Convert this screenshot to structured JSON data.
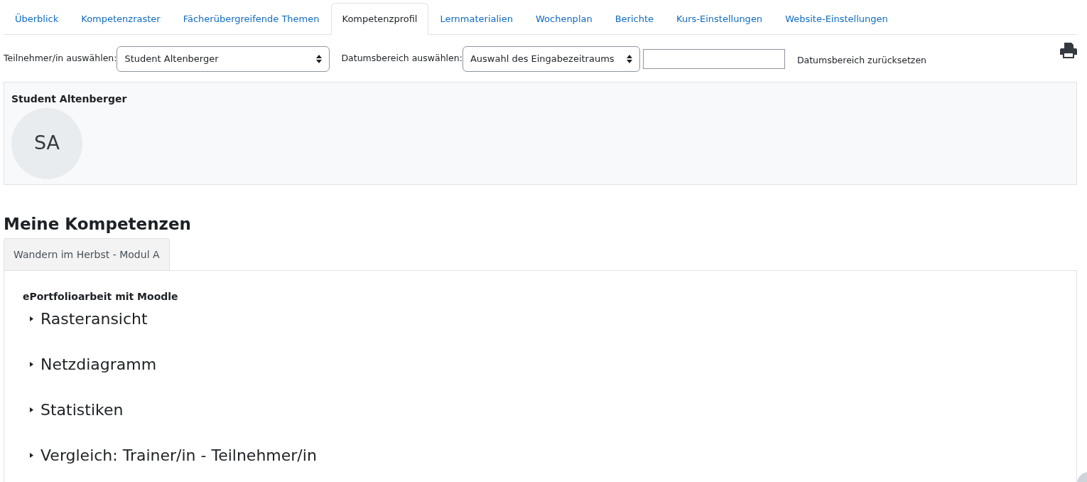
{
  "tabs": [
    {
      "label": "Überblick",
      "selected": false
    },
    {
      "label": "Kompetenzraster",
      "selected": false
    },
    {
      "label": "Fächerübergreifende Themen",
      "selected": false
    },
    {
      "label": "Kompetenzprofil",
      "selected": true
    },
    {
      "label": "Lernmaterialien",
      "selected": false
    },
    {
      "label": "Wochenplan",
      "selected": false
    },
    {
      "label": "Berichte",
      "selected": false
    },
    {
      "label": "Kurs-Einstellungen",
      "selected": false
    },
    {
      "label": "Website-Einstellungen",
      "selected": false
    }
  ],
  "filters": {
    "participant_label": "Teilnehmer/in auswählen:",
    "participant_value": "Student Altenberger",
    "date_label": "Datumsbereich auswählen:",
    "date_value": "Auswahl des Eingabezeitraums",
    "reset_label": "Datumsbereich zurücksetzen"
  },
  "profile": {
    "name": "Student Altenberger",
    "initials": "SA"
  },
  "heading": "Meine Kompetenzen",
  "course_tabs": [
    {
      "label": "Wandern im Herbst - Modul A",
      "selected": true
    }
  ],
  "section": {
    "title": "ePortfolioarbeit mit Moodle",
    "items": [
      {
        "label": "Rasteransicht",
        "expanded": false
      },
      {
        "label": "Netzdiagramm",
        "expanded": false
      },
      {
        "label": "Statistiken",
        "expanded": false
      },
      {
        "label": "Vergleich: Trainer/in - Teilnehmer/in",
        "expanded": false
      }
    ]
  }
}
